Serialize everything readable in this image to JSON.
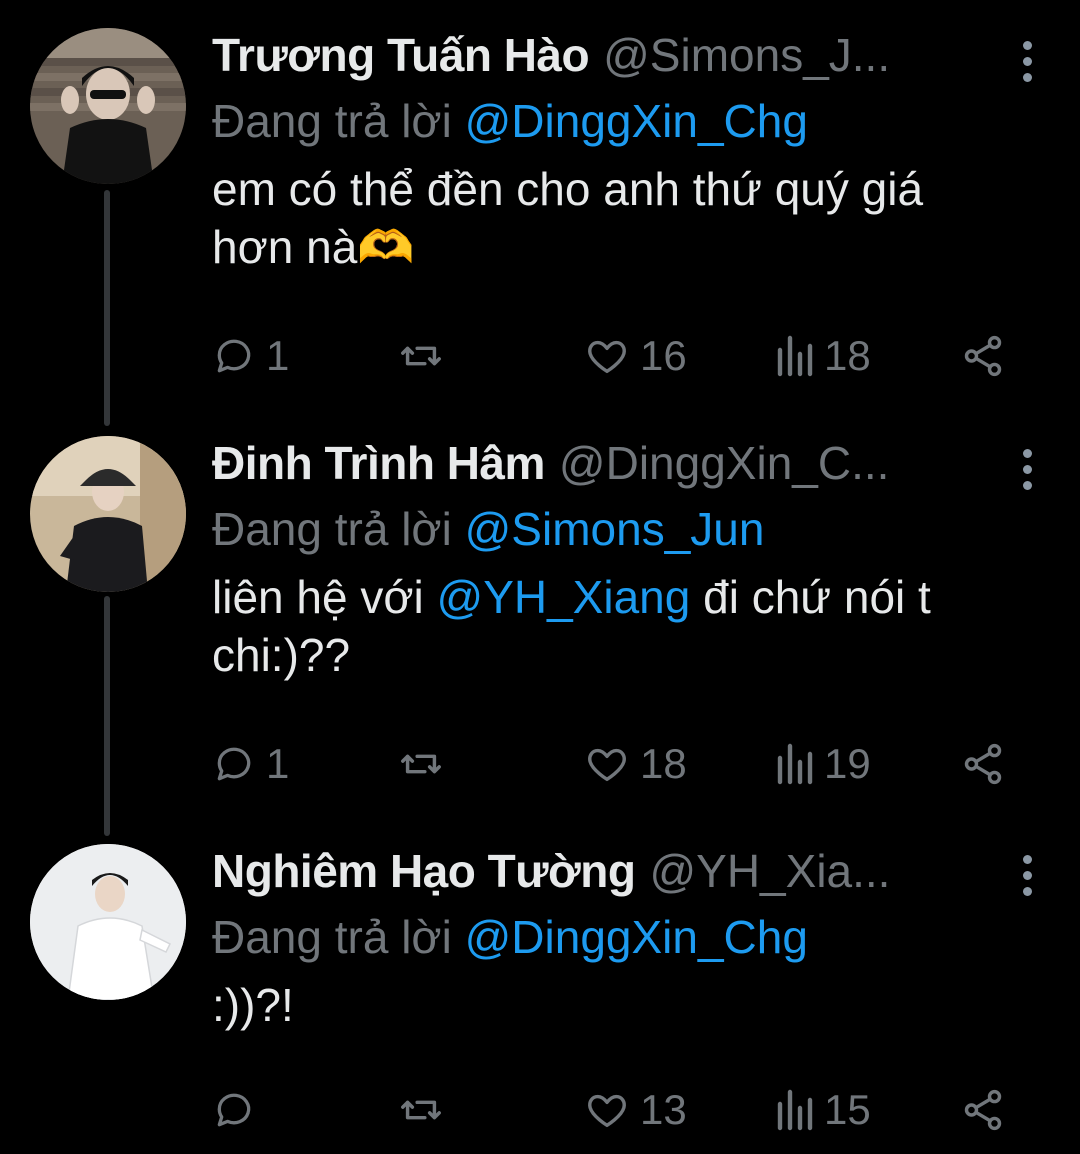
{
  "tweets": [
    {
      "display_name": "Trương Tuấn Hào",
      "handle": "@Simons_J...",
      "replying_label": "Đang trả lời",
      "replying_to": "@DinggXin_Chg",
      "body_parts": [
        {
          "text": "em có thể đền cho anh thứ quý giá hơn nà🫶",
          "mention": false
        }
      ],
      "replies": "1",
      "retweets": "",
      "likes": "16",
      "views": "18"
    },
    {
      "display_name": "Đinh Trình Hâm",
      "handle": "@DinggXin_C...",
      "replying_label": "Đang trả lời",
      "replying_to": "@Simons_Jun",
      "body_parts": [
        {
          "text": "liên hệ với ",
          "mention": false
        },
        {
          "text": "@YH_Xiang",
          "mention": true
        },
        {
          "text": " đi chứ nói t chi:)??",
          "mention": false
        }
      ],
      "replies": "1",
      "retweets": "",
      "likes": "18",
      "views": "19"
    },
    {
      "display_name": "Nghiêm Hạo Tường",
      "handle": "@YH_Xia...",
      "replying_label": "Đang trả lời",
      "replying_to": "@DinggXin_Chg",
      "body_parts": [
        {
          "text": ":))?!",
          "mention": false
        }
      ],
      "replies": "",
      "retweets": "",
      "likes": "13",
      "views": "15"
    }
  ],
  "colors": {
    "background": "#000000",
    "primary_text": "#e7e9ea",
    "secondary_text": "#71767b",
    "mention": "#1d9bf0",
    "thread_line": "#333639"
  },
  "icons": [
    "reply-icon",
    "retweet-icon",
    "like-icon",
    "views-icon",
    "share-icon",
    "more-icon"
  ]
}
